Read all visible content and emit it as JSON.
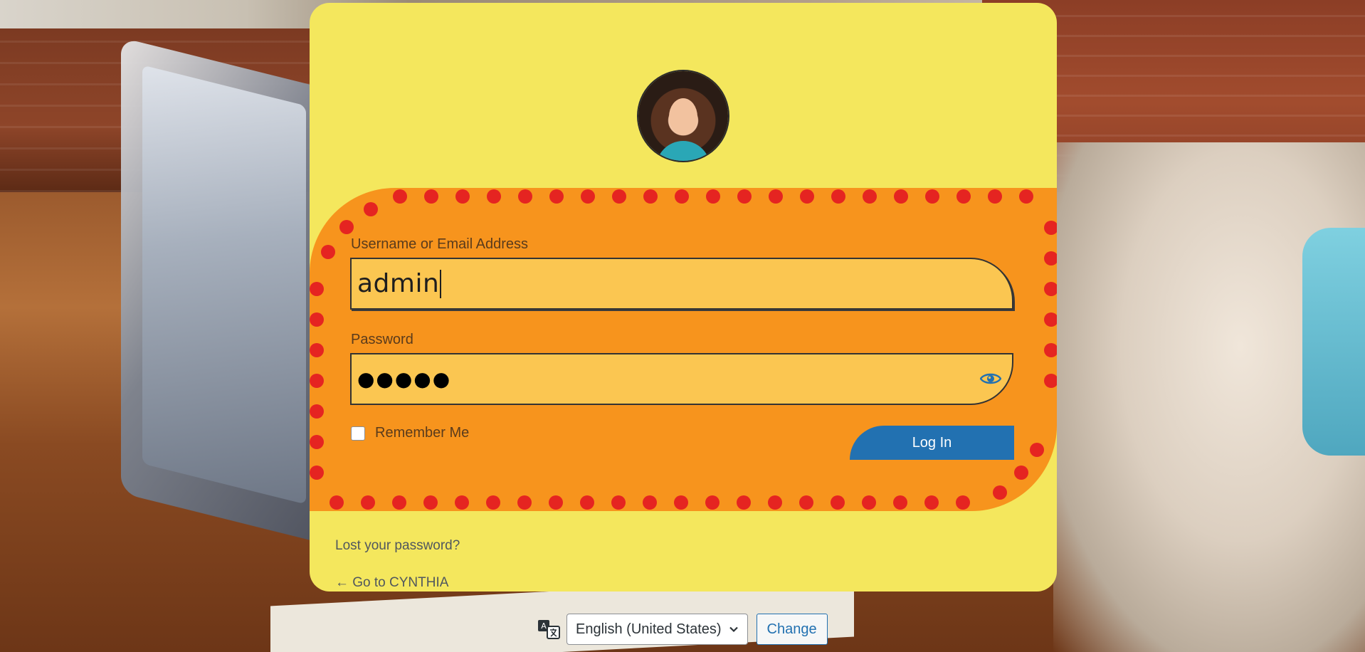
{
  "form": {
    "username_label": "Username or Email Address",
    "username_value": "admin",
    "password_label": "Password",
    "password_masked": "●●●●●",
    "remember_label": "Remember Me",
    "login_button": "Log In"
  },
  "links": {
    "lost_password": "Lost your password?",
    "back_to_site": "← Go to CYNTHIA"
  },
  "language": {
    "selected": "English (United States)",
    "change_button": "Change"
  },
  "icons": {
    "password_toggle": "eye-icon",
    "language": "translate-icon",
    "select": "chevron-down-icon"
  },
  "colors": {
    "card": "#f4e75d",
    "form_panel": "#f7941d",
    "dots": "#e52421",
    "input": "#fbc651",
    "primary": "#2271b1"
  }
}
